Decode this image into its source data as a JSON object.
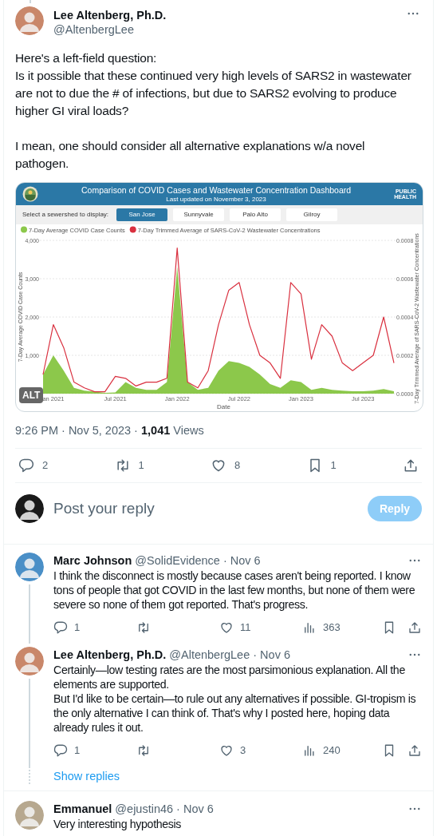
{
  "tweet": {
    "author_name": "Lee Altenberg, Ph.D.",
    "handle": "@AltenbergLee",
    "paragraphs": [
      "Here's a left-field question:\nIs it possible that these continued very high levels of SARS2 in wastewater are not to due the # of infections, but due to SARS2 evolving to produce higher GI viral loads?",
      "I mean, one should consider all alternative explanations w/a novel\npathogen."
    ],
    "media": {
      "title": "Comparison of COVID Cases and Wastewater Concentration Dashboard",
      "subtitle": "Last updated on November 3, 2023",
      "logo": [
        "PUBLIC",
        "HEALTH"
      ],
      "select_label": "Select a sewershed to display:",
      "sewersheds": [
        {
          "label": "San Jose",
          "selected": true
        },
        {
          "label": "Sunnyvale",
          "selected": false
        },
        {
          "label": "Palo Alto",
          "selected": false
        },
        {
          "label": "Gilroy",
          "selected": false
        }
      ],
      "alt_badge": "ALT",
      "chart_data": {
        "type": "line",
        "grid": true,
        "legend": "top-left",
        "xlabel": "Date",
        "ylabel": "7-Day Average COVID Case Counts",
        "ylim": [
          0,
          4000
        ],
        "y2label": "7-Day Trimmed Average of SARS-CoV-2 Wastewater Concentrations",
        "y2lim": [
          0,
          0.0008
        ],
        "y2ticks": [
          {
            "value": 0.0008,
            "label": "0.0008"
          },
          {
            "value": 0.0006,
            "label": "0.0006"
          },
          {
            "value": 0.0004,
            "label": "0.0004"
          },
          {
            "value": 0.0002,
            "label": "0.0002"
          },
          {
            "value": 0,
            "label": "0.0000"
          }
        ],
        "categories": [
          null,
          "an 2021",
          null,
          null,
          null,
          null,
          null,
          "Jul 2021",
          null,
          null,
          null,
          null,
          null,
          "Jan 2022",
          null,
          null,
          null,
          null,
          null,
          "Jul 2022",
          null,
          null,
          null,
          null,
          null,
          "Jan 2023",
          null,
          null,
          null,
          null,
          null,
          "Jul 2023",
          null,
          null,
          null
        ],
        "yticks": [
          {
            "value": 1000,
            "label": "1,000"
          },
          {
            "value": 2000,
            "label": "2,000"
          },
          {
            "value": 3000,
            "label": "3,000"
          },
          {
            "value": 4000,
            "label": "4,000"
          }
        ],
        "series": [
          {
            "name": "7-Day Average COVID Case Counts",
            "color": "#8cc84b",
            "type": "area",
            "values": [
              500,
              1000,
              600,
              150,
              80,
              50,
              20,
              30,
              300,
              150,
              100,
              100,
              300,
              3300,
              300,
              100,
              150,
              600,
              850,
              800,
              700,
              500,
              250,
              150,
              350,
              300,
              100,
              150,
              100,
              80,
              60,
              60,
              80,
              120,
              60
            ]
          },
          {
            "name": "7-Day Trimmed Average of SARS-CoV-2 Wastewater Concentrations",
            "color": "#d9303f",
            "axis": "y2",
            "values": [
              0.0001,
              0.00036,
              0.00024,
              6e-05,
              3e-05,
              1e-05,
              1e-05,
              9e-05,
              8e-05,
              4e-05,
              6e-05,
              6e-05,
              8e-05,
              0.00076,
              6e-05,
              3e-05,
              0.00012,
              0.00036,
              0.00054,
              0.00058,
              0.00036,
              0.0002,
              0.00016,
              8e-05,
              0.00058,
              0.00052,
              0.00018,
              0.00036,
              0.0003,
              0.00016,
              0.00012,
              0.00016,
              0.0002,
              0.0004,
              0.00016
            ]
          }
        ]
      }
    },
    "meta": "9:26 PM · Nov 5, 2023 · **1,041** Views",
    "actions": [
      {
        "kind": "reply",
        "count": "2"
      },
      {
        "kind": "repost",
        "count": "1"
      },
      {
        "kind": "like",
        "count": "8"
      },
      {
        "kind": "bookmark",
        "count": "1"
      },
      {
        "kind": "share"
      }
    ]
  },
  "reply_box": {
    "placeholder": "Post your reply",
    "button": "Reply",
    "disabled": true
  },
  "replies": [
    {
      "name": "Marc Johnson",
      "handle": "@SolidEvidence",
      "date": "· Nov 6",
      "text": "I think the disconnect is mostly because cases aren't being reported. I know tons of people that got COVID in the last few months, but none of them were severe so none of them got reported. That's progress.",
      "connected_below": true,
      "actions": [
        {
          "kind": "reply",
          "count": "1"
        },
        {
          "kind": "repost"
        },
        {
          "kind": "like",
          "count": "11"
        },
        {
          "kind": "views",
          "count": "363"
        },
        {
          "kind": "bookmark"
        },
        {
          "kind": "share"
        }
      ]
    },
    {
      "name": "Lee Altenberg, Ph.D.",
      "handle": "@AltenbergLee",
      "date": "· Nov 6",
      "text": "Certainly—low testing rates are the most parsimonious explanation. All the elements are supported.\nBut I'd like to be certain—to rule out any alternatives if possible. GI-tropism is the only alternative I can think of. That's why I posted here, hoping data already rules it out.",
      "connected_below": true,
      "show_replies": "Show replies",
      "actions": [
        {
          "kind": "reply",
          "count": "1"
        },
        {
          "kind": "repost"
        },
        {
          "kind": "like",
          "count": "3"
        },
        {
          "kind": "views",
          "count": "240"
        },
        {
          "kind": "bookmark"
        },
        {
          "kind": "share"
        }
      ]
    },
    {
      "name": "Emmanuel",
      "handle": "@ejustin46",
      "date": "· Nov 6",
      "text": "Very interesting hypothesis",
      "connected_below": false
    }
  ]
}
